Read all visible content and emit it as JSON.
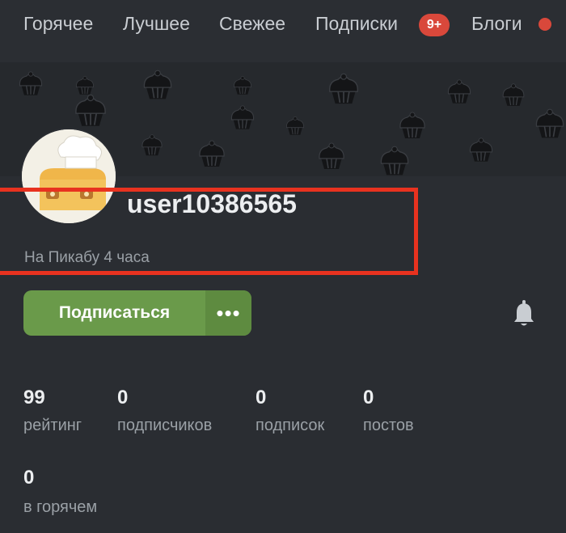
{
  "nav": {
    "items": [
      "Горячее",
      "Лучшее",
      "Свежее",
      "Подписки",
      "Блоги"
    ],
    "badge": "9+"
  },
  "profile": {
    "username": "user10386565",
    "since": "На Пикабу 4 часа"
  },
  "actions": {
    "subscribe_label": "Подписаться",
    "more_label": "•••"
  },
  "stats": [
    {
      "value": "99",
      "label": "рейтинг"
    },
    {
      "value": "0",
      "label": "подписчиков"
    },
    {
      "value": "0",
      "label": "подписок"
    },
    {
      "value": "0",
      "label": "постов"
    },
    {
      "value": "0",
      "label": "в горячем"
    }
  ],
  "colors": {
    "accent_green": "#6a9a4a",
    "badge_red": "#d9483b",
    "highlight_red": "#e8321f"
  }
}
